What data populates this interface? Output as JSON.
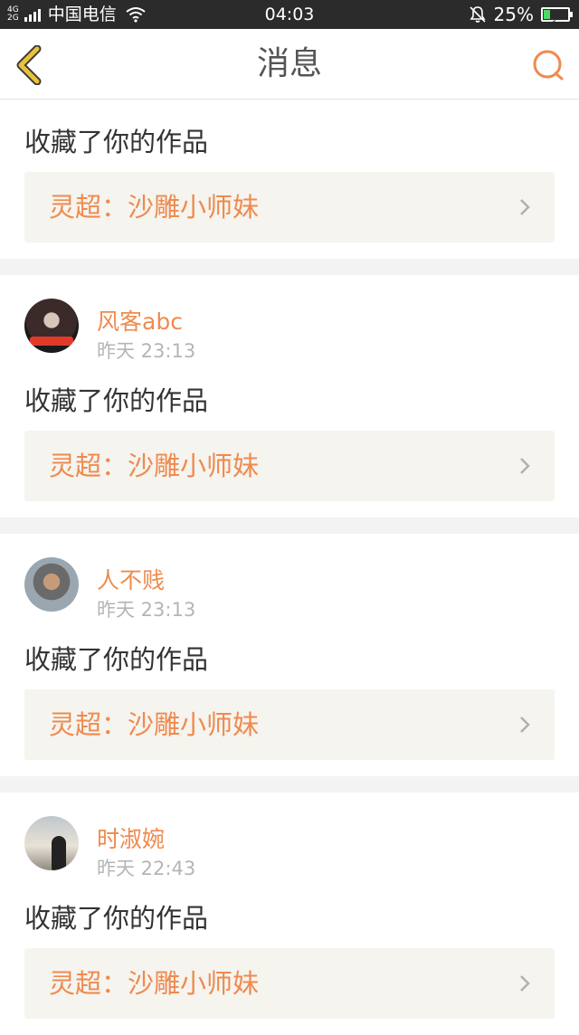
{
  "status_bar": {
    "network_top": "4G",
    "network_bottom": "2G",
    "carrier": "中国电信",
    "time": "04:03",
    "battery": "25%",
    "battery_level": 0.25
  },
  "header": {
    "title": "消息",
    "back_icon": "chevron-left-icon",
    "search_icon": "search-icon"
  },
  "messages": [
    {
      "action": "收藏了你的作品",
      "work_title": "灵超：沙雕小师妹"
    },
    {
      "username": "风客abc",
      "time": "昨天 23:13",
      "action": "收藏了你的作品",
      "work_title": "灵超：沙雕小师妹"
    },
    {
      "username": "人不贱",
      "time": "昨天 23:13",
      "action": "收藏了你的作品",
      "work_title": "灵超：沙雕小师妹"
    },
    {
      "username": "时淑婉",
      "time": "昨天 22:43",
      "action": "收藏了你的作品",
      "work_title": "灵超：沙雕小师妹"
    }
  ],
  "colors": {
    "accent": "#ef8a4e",
    "back_icon": "#e8c23a",
    "link_bg": "#f5f4ef",
    "divider": "#f3f3f3"
  }
}
